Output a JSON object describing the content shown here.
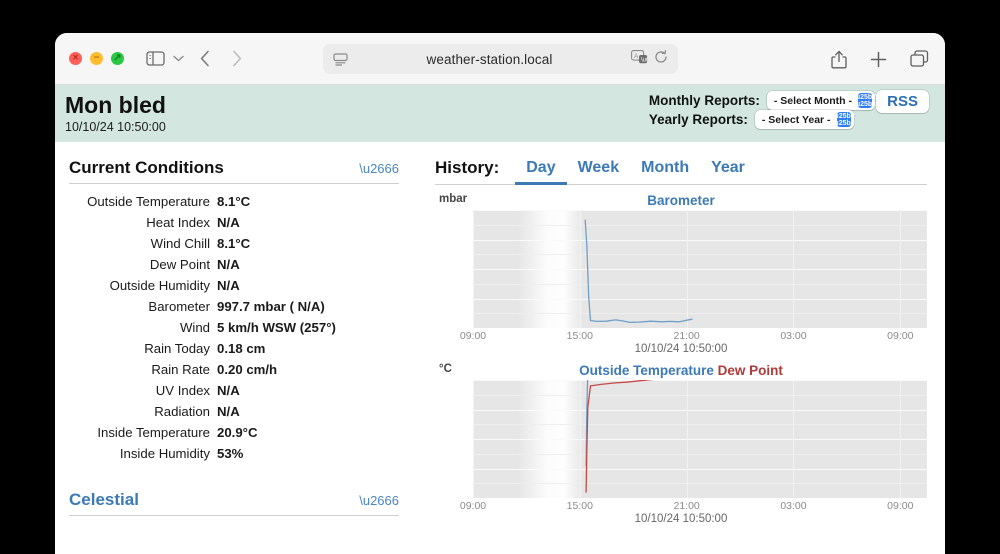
{
  "browser": {
    "url": "weather-station.local",
    "icons": {
      "reader": "reader-icon",
      "translate": "translate-icon",
      "reload": "reload-icon",
      "share": "share-icon",
      "new_tab": "plus-icon",
      "tab_overview": "tab-overview-icon",
      "sidebar": "sidebar-toggle-icon",
      "back": "back-chevron-icon",
      "forward": "forward-chevron-icon"
    },
    "traffic": {
      "close": "×",
      "minimize": "−",
      "zoom": "↗"
    }
  },
  "header": {
    "title": "Mon bled",
    "timestamp": "10/10/24 10:50:00",
    "monthly_label": "Monthly Reports:",
    "monthly_value": "- Select Month -",
    "yearly_label": "Yearly Reports:",
    "yearly_value": "- Select Year -",
    "rss_label": "RSS"
  },
  "current_conditions": {
    "title": "Current Conditions",
    "rows": [
      {
        "label": "Outside Temperature",
        "value": "8.1°C"
      },
      {
        "label": "Heat Index",
        "value": "N/A"
      },
      {
        "label": "Wind Chill",
        "value": "8.1°C"
      },
      {
        "label": "Dew Point",
        "value": "N/A"
      },
      {
        "label": "Outside Humidity",
        "value": "N/A"
      },
      {
        "label": "Barometer",
        "value": "997.7 mbar ( N/A)"
      },
      {
        "label": "Wind",
        "value": "5 km/h WSW (257°)"
      },
      {
        "label": "Rain Today",
        "value": "0.18 cm"
      },
      {
        "label": "Rain Rate",
        "value": "0.20 cm/h"
      },
      {
        "label": "UV Index",
        "value": "N/A"
      },
      {
        "label": "Radiation",
        "value": "N/A"
      },
      {
        "label": "Inside Temperature",
        "value": "20.9°C"
      },
      {
        "label": "Inside Humidity",
        "value": "53%"
      }
    ]
  },
  "celestial": {
    "title": "Celestial"
  },
  "history": {
    "label": "History:",
    "tabs": [
      {
        "label": "Day",
        "active": true
      },
      {
        "label": "Week",
        "active": false
      },
      {
        "label": "Month",
        "active": false
      },
      {
        "label": "Year",
        "active": false
      }
    ]
  },
  "colors": {
    "accent_blue": "#3c7ab5",
    "dew_red": "#b03a3a",
    "header_band": "#d3e7e0",
    "plot_bg": "#e6e6e6"
  },
  "chart_data": [
    {
      "type": "line",
      "title": "Barometer",
      "ylabel": "mbar",
      "xlabel": "10/10/24 10:50:00",
      "ylim": [
        980,
        1060
      ],
      "yticks": [
        980,
        1000,
        1020,
        1040,
        1060
      ],
      "xticks": [
        "09:00",
        "15:00",
        "21:00",
        "03:00",
        "09:00"
      ],
      "grid": true,
      "series": [
        {
          "name": "Barometer",
          "color": "#6f9fc8",
          "points": [
            [
              15.3,
              1053
            ],
            [
              15.4,
              1035
            ],
            [
              15.5,
              1001
            ],
            [
              15.6,
              985
            ],
            [
              16.0,
              984.5
            ],
            [
              16.5,
              984.6
            ],
            [
              17.0,
              985.5
            ],
            [
              17.4,
              984.8
            ],
            [
              17.8,
              983.8
            ],
            [
              18.3,
              984.0
            ],
            [
              19.0,
              984.6
            ],
            [
              19.6,
              984.2
            ],
            [
              20.1,
              984.5
            ],
            [
              20.6,
              984.2
            ],
            [
              21.0,
              985.3
            ],
            [
              21.3,
              986.0
            ]
          ]
        }
      ]
    },
    {
      "type": "line",
      "title_parts": [
        "Outside Temperature",
        "Dew Point"
      ],
      "ylabel": "°C",
      "xlabel": "10/10/24 10:50:00",
      "ylim": [
        -4,
        12
      ],
      "yticks": [
        -4,
        0,
        4,
        8,
        12
      ],
      "xticks": [
        "09:00",
        "15:00",
        "21:00",
        "03:00",
        "09:00"
      ],
      "grid": true,
      "series": [
        {
          "name": "Outside Temperature",
          "color": "#6f9fc8",
          "points": [
            [
              15.35,
              0.4
            ],
            [
              15.4,
              8.4
            ],
            [
              15.45,
              13.0
            ],
            [
              16.0,
              12.9
            ],
            [
              16.6,
              12.4
            ],
            [
              17.2,
              12.3
            ],
            [
              17.9,
              12.3
            ],
            [
              18.6,
              12.4
            ],
            [
              19.3,
              12.8
            ],
            [
              20.0,
              13.0
            ],
            [
              20.7,
              13.1
            ],
            [
              21.2,
              13.1
            ]
          ]
        },
        {
          "name": "Dew Point",
          "color": "#c24a48",
          "points": [
            [
              15.35,
              -3.2
            ],
            [
              15.4,
              2.8
            ],
            [
              15.45,
              8.3
            ],
            [
              15.6,
              11.2
            ],
            [
              16.2,
              11.4
            ],
            [
              16.9,
              11.6
            ],
            [
              17.6,
              11.7
            ],
            [
              18.4,
              11.9
            ],
            [
              19.2,
              12.1
            ],
            [
              20.0,
              12.3
            ],
            [
              20.7,
              12.4
            ],
            [
              21.2,
              12.4
            ]
          ]
        }
      ]
    }
  ]
}
